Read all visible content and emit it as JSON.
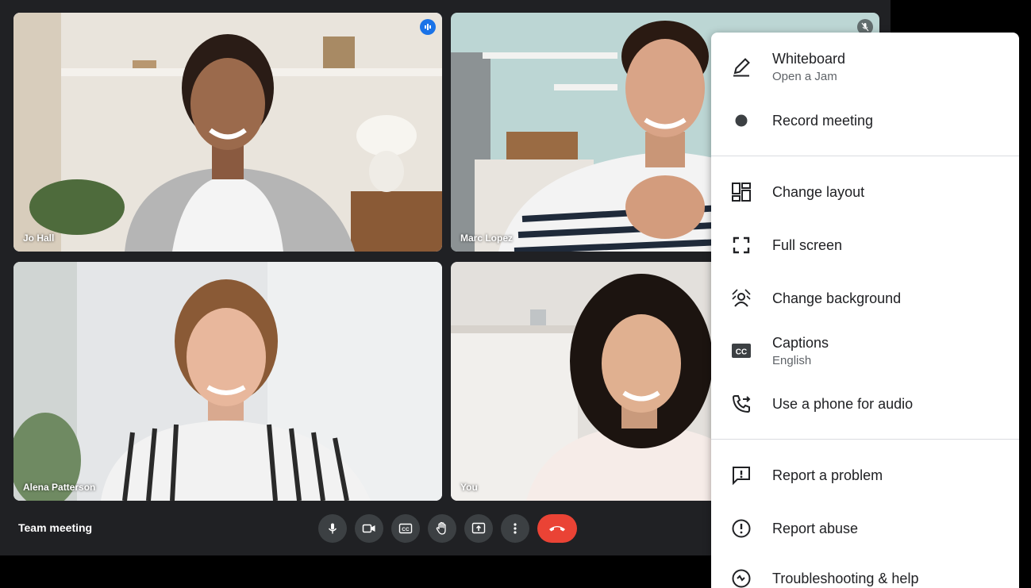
{
  "meeting": {
    "title": "Team meeting"
  },
  "participants": [
    {
      "name": "Jo Hall"
    },
    {
      "name": "Marc Lopez"
    },
    {
      "name": "Alena Patterson"
    },
    {
      "name": "You"
    }
  ],
  "menu": {
    "whiteboard": {
      "label": "Whiteboard",
      "sub": "Open a Jam"
    },
    "record": {
      "label": "Record meeting"
    },
    "layout": {
      "label": "Change layout"
    },
    "fullscreen": {
      "label": "Full screen"
    },
    "background": {
      "label": "Change background"
    },
    "captions": {
      "label": "Captions",
      "sub": "English"
    },
    "phone": {
      "label": "Use a phone for audio"
    },
    "report_problem": {
      "label": "Report a problem"
    },
    "report_abuse": {
      "label": "Report abuse"
    },
    "troubleshooting": {
      "label": "Troubleshooting & help"
    }
  },
  "colors": {
    "accent": "#1a73e8",
    "end_call": "#ea4335",
    "dark_bg": "#202124"
  },
  "icons": [
    "mic-icon",
    "camera-icon",
    "captions-icon",
    "raise-hand-icon",
    "present-icon",
    "more-options-icon",
    "end-call-icon"
  ]
}
